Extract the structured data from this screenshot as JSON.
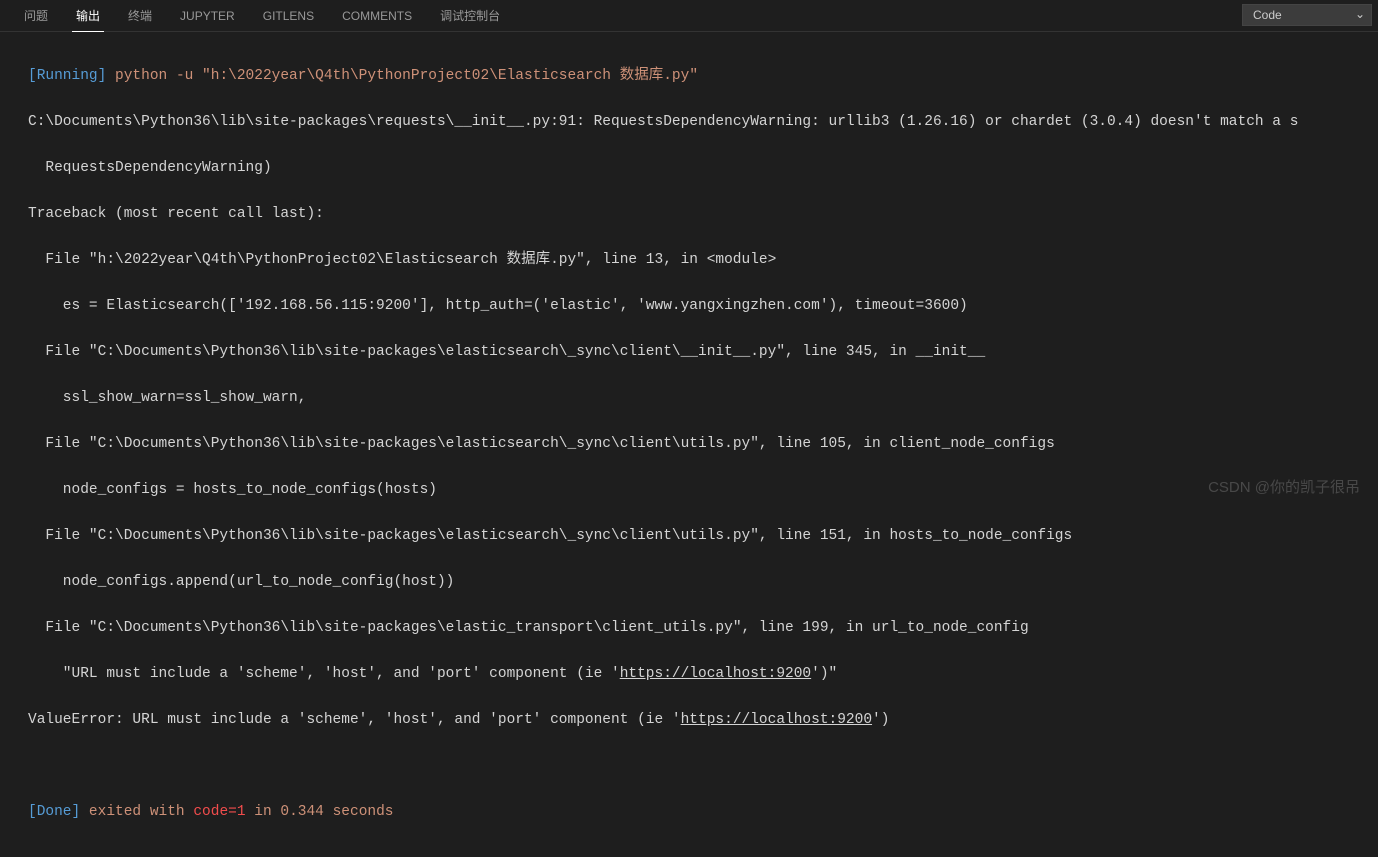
{
  "tabs": {
    "items": [
      "问题",
      "输出",
      "终端",
      "JUPYTER",
      "GITLENS",
      "COMMENTS",
      "调试控制台"
    ],
    "active_index": 1
  },
  "dropdown": {
    "selected": "Code"
  },
  "output": {
    "running_label": "[Running]",
    "running_cmd": " python -u \"h:\\2022year\\Q4th\\PythonProject02\\Elasticsearch 数据库.py\"",
    "line2": "C:\\Documents\\Python36\\lib\\site-packages\\requests\\__init__.py:91: RequestsDependencyWarning: urllib3 (1.26.16) or chardet (3.0.4) doesn't match a s",
    "line3": "  RequestsDependencyWarning)",
    "line4": "Traceback (most recent call last):",
    "line5": "  File \"h:\\2022year\\Q4th\\PythonProject02\\Elasticsearch 数据库.py\", line 13, in <module>",
    "line6": "    es = Elasticsearch(['192.168.56.115:9200'], http_auth=('elastic', 'www.yangxingzhen.com'), timeout=3600)",
    "line7": "  File \"C:\\Documents\\Python36\\lib\\site-packages\\elasticsearch\\_sync\\client\\__init__.py\", line 345, in __init__",
    "line8": "    ssl_show_warn=ssl_show_warn,",
    "line9": "  File \"C:\\Documents\\Python36\\lib\\site-packages\\elasticsearch\\_sync\\client\\utils.py\", line 105, in client_node_configs",
    "line10": "    node_configs = hosts_to_node_configs(hosts)",
    "line11": "  File \"C:\\Documents\\Python36\\lib\\site-packages\\elasticsearch\\_sync\\client\\utils.py\", line 151, in hosts_to_node_configs",
    "line12": "    node_configs.append(url_to_node_config(host))",
    "line13": "  File \"C:\\Documents\\Python36\\lib\\site-packages\\elastic_transport\\client_utils.py\", line 199, in url_to_node_config",
    "line14a": "    \"URL must include a 'scheme', 'host', and 'port' component (ie '",
    "line14b": "https://localhost:9200",
    "line14c": "')\"",
    "line15a": "ValueError: URL must include a 'scheme', 'host', and 'port' component (ie '",
    "line15b": "https://localhost:9200",
    "line15c": "')",
    "done_label": "[Done]",
    "done_a": " exited with ",
    "done_code": "code=1",
    "done_b": " in ",
    "done_time": "0.344 seconds"
  },
  "watermark": "CSDN @你的凯子很吊"
}
